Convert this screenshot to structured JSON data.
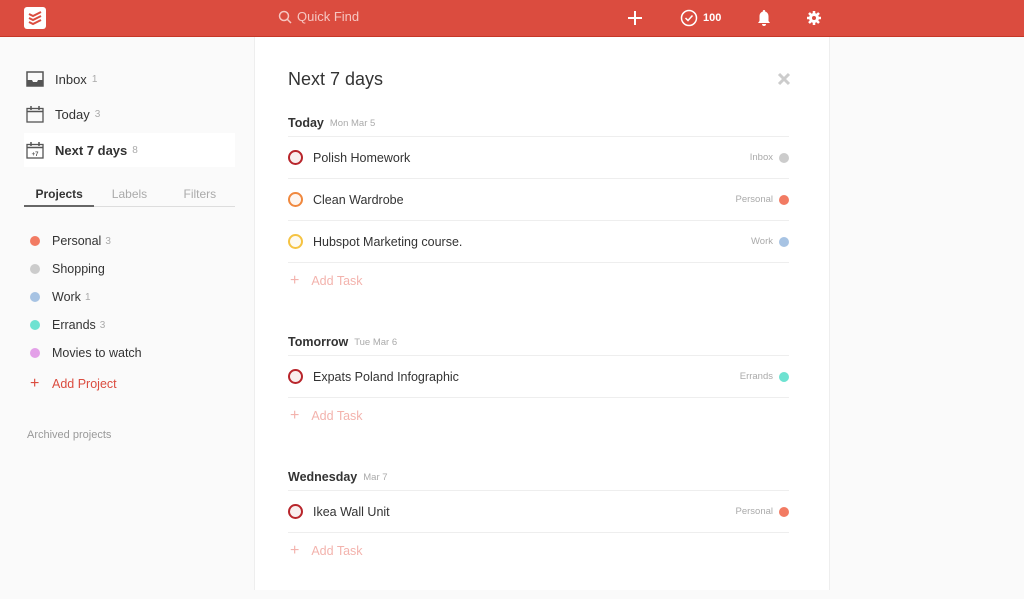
{
  "header": {
    "search_placeholder": "Quick Find",
    "karma": "100"
  },
  "sidebar": {
    "nav": [
      {
        "label": "Inbox",
        "count": "1"
      },
      {
        "label": "Today",
        "count": "3"
      },
      {
        "label": "Next 7 days",
        "count": "8"
      }
    ],
    "tabs": [
      "Projects",
      "Labels",
      "Filters"
    ],
    "projects": [
      {
        "label": "Personal",
        "count": "3",
        "color": "#f27b63"
      },
      {
        "label": "Shopping",
        "count": "",
        "color": "#cccccc"
      },
      {
        "label": "Work",
        "count": "1",
        "color": "#a7c3e3"
      },
      {
        "label": "Errands",
        "count": "3",
        "color": "#6ee2d1"
      },
      {
        "label": "Movies to watch",
        "count": "",
        "color": "#e3a0e8"
      }
    ],
    "add_project": "Add Project",
    "archived": "Archived projects"
  },
  "main": {
    "title": "Next 7 days",
    "add_task": "Add Task",
    "sections": [
      {
        "day": "Today",
        "date": "Mon Mar 5",
        "tasks": [
          {
            "name": "Polish Homework",
            "project": "Inbox",
            "priority_color": "#b8252b",
            "project_color": "#cccccc"
          },
          {
            "name": "Clean Wardrobe",
            "project": "Personal",
            "priority_color": "#f0883e",
            "project_color": "#f27b63"
          },
          {
            "name": "Hubspot Marketing course.",
            "project": "Work",
            "priority_color": "#f5c342",
            "project_color": "#a7c3e3"
          }
        ]
      },
      {
        "day": "Tomorrow",
        "date": "Tue Mar 6",
        "tasks": [
          {
            "name": "Expats Poland Infographic",
            "project": "Errands",
            "priority_color": "#b8252b",
            "project_color": "#6ee2d1"
          }
        ]
      },
      {
        "day": "Wednesday",
        "date": "Mar 7",
        "tasks": [
          {
            "name": "Ikea Wall Unit",
            "project": "Personal",
            "priority_color": "#b8252b",
            "project_color": "#f27b63"
          }
        ]
      }
    ]
  }
}
